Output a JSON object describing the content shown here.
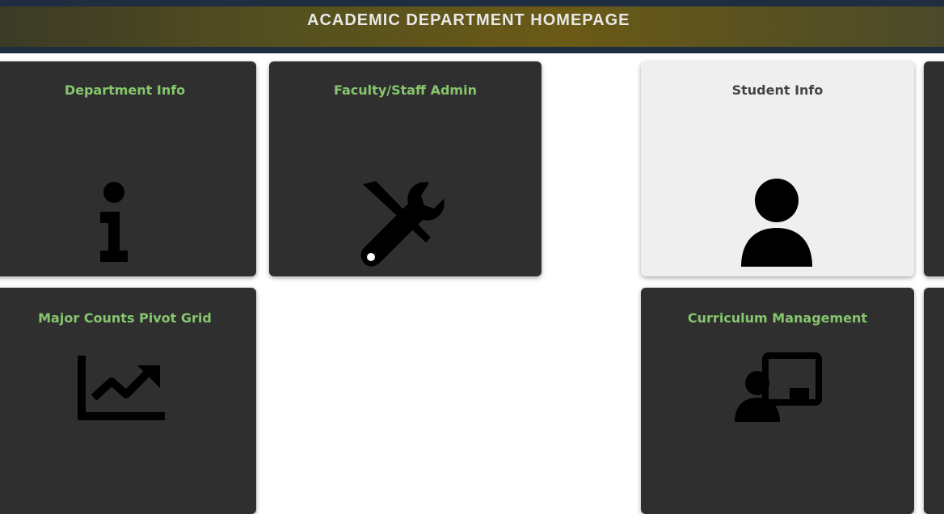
{
  "header": {
    "title": "ACADEMIC DEPARTMENT HOMEPAGE",
    "subtitle": "",
    "right_text": "",
    "bg_color": "#1e2d3f",
    "accent_color": "#6a5a16"
  },
  "tiles": [
    {
      "title": "Department Info",
      "icon": "info-icon",
      "theme": "dark"
    },
    {
      "title": "Faculty/Staff Admin",
      "icon": "tools-icon",
      "theme": "dark"
    },
    {
      "title": "Student Info",
      "icon": "user-icon",
      "theme": "light"
    },
    {
      "title": "",
      "icon": "",
      "theme": "dark"
    },
    {
      "title": "Major Counts Pivot Grid",
      "icon": "chart-line-icon",
      "theme": "dark"
    },
    {
      "title": "Curriculum Management",
      "icon": "chalkboard-user-icon",
      "theme": "dark"
    },
    {
      "title": "",
      "icon": "",
      "theme": "dark"
    }
  ],
  "colors": {
    "tile_dark": "#2f2f2f",
    "tile_light": "#efefef",
    "title_green": "#86c56d"
  }
}
